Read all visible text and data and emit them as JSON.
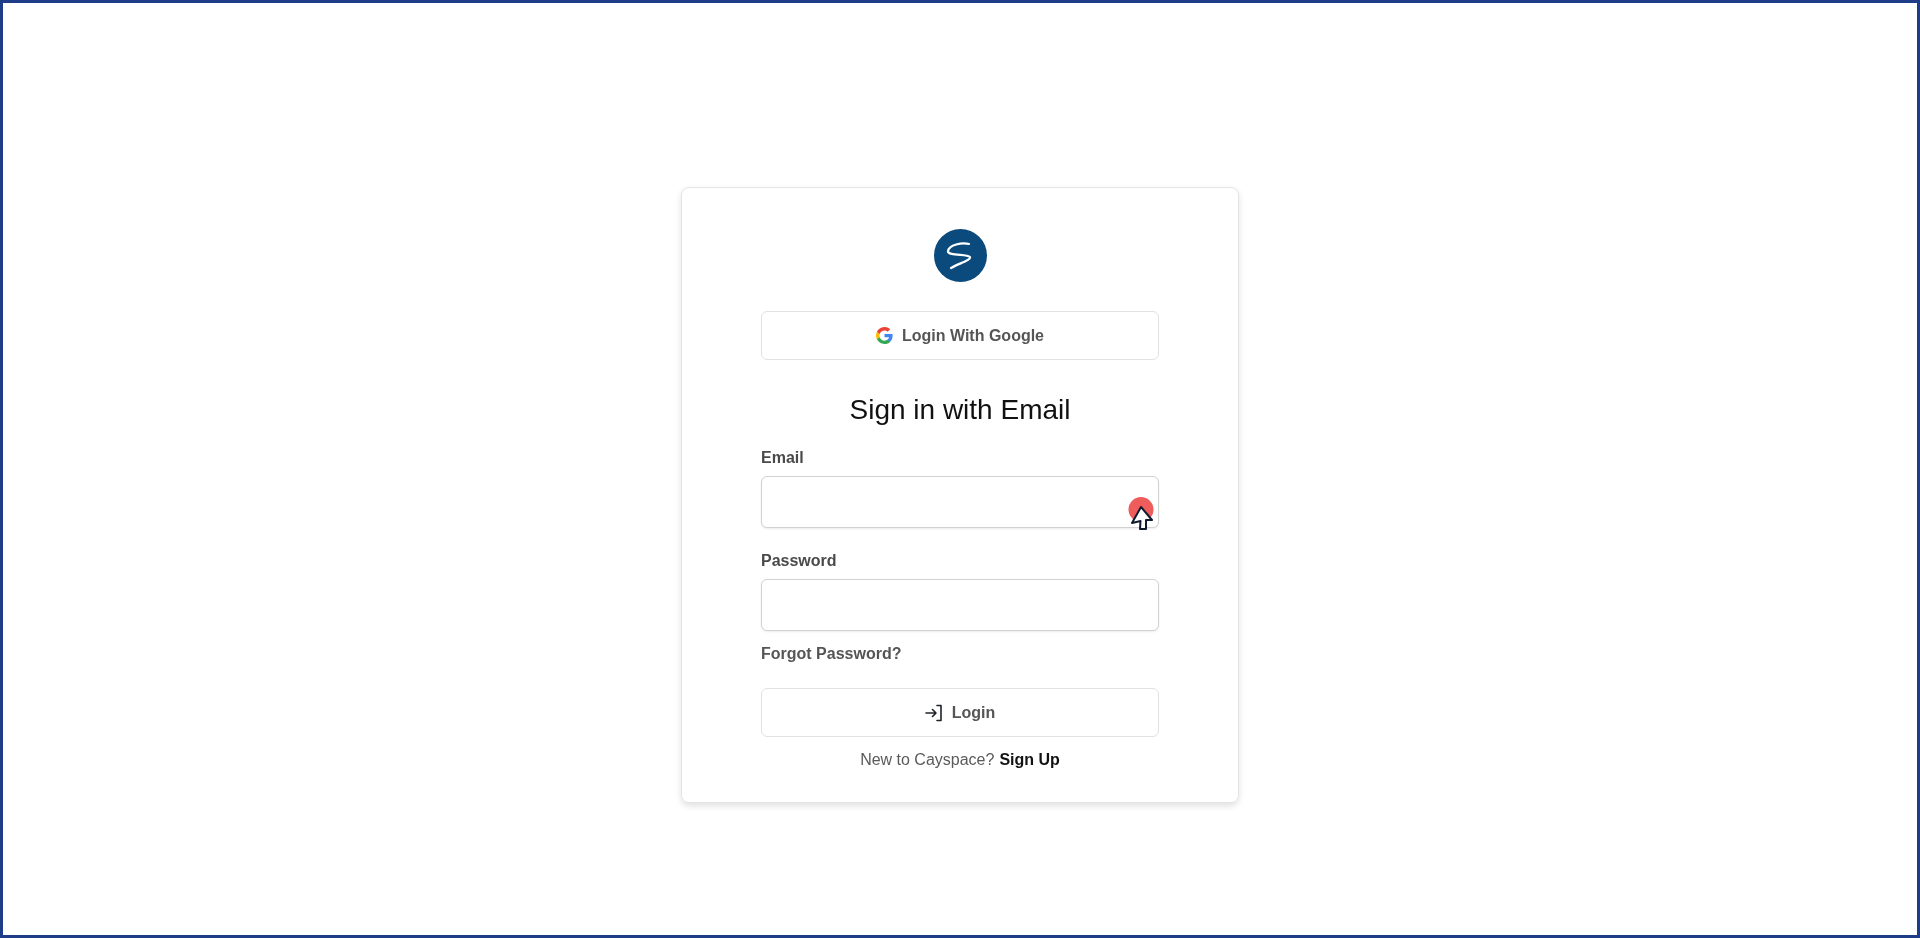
{
  "google_button": {
    "label": "Login With Google"
  },
  "heading": "Sign in with Email",
  "fields": [
    {
      "label": "Email"
    },
    {
      "label": "Password"
    }
  ],
  "forgot_link": "Forgot Password?",
  "login_button": {
    "label": "Login"
  },
  "signup": {
    "prompt": "New to Cayspace?",
    "link": "Sign Up"
  }
}
